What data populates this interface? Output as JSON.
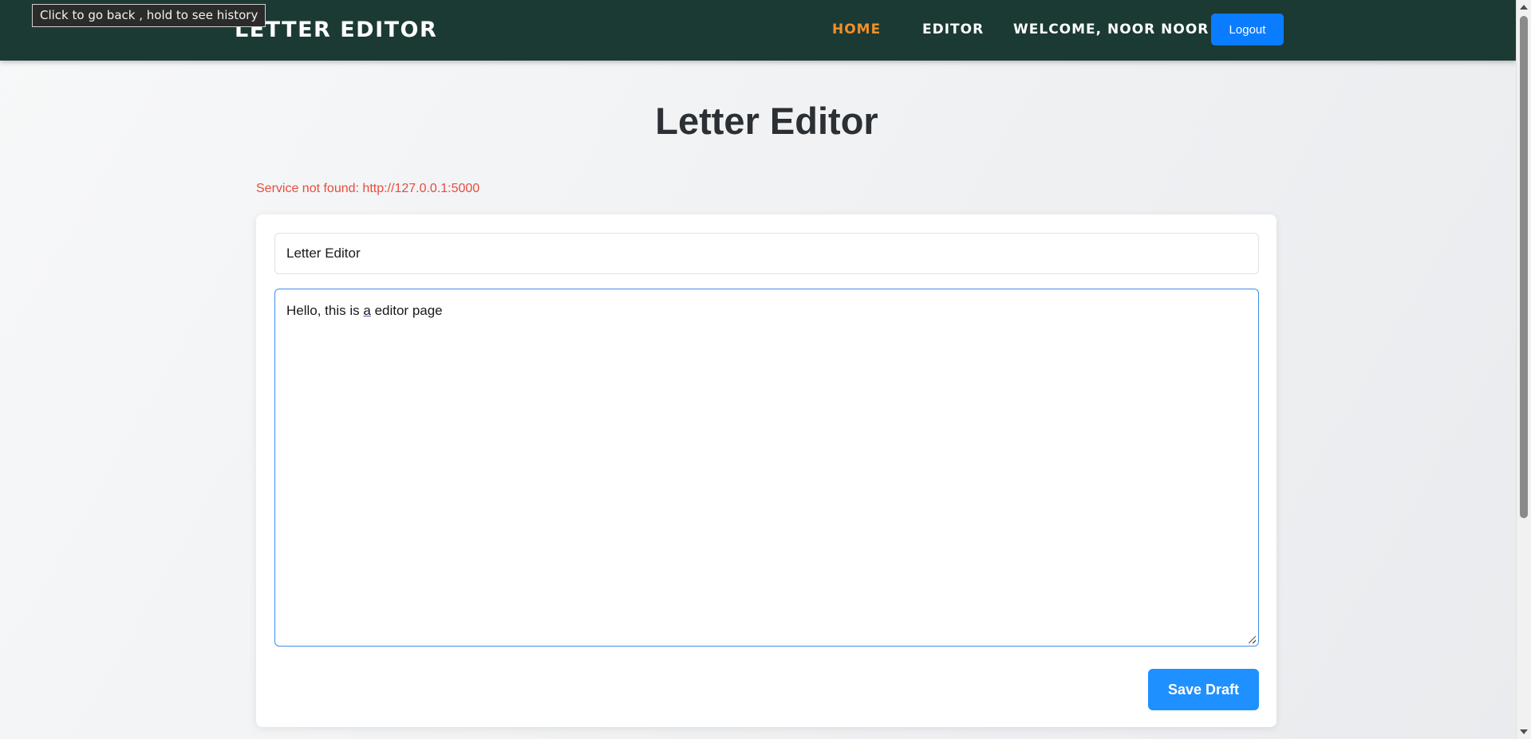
{
  "tooltip": {
    "text": "Click to go back , hold to see history"
  },
  "nav": {
    "brand": "LETTER EDITOR",
    "links": [
      {
        "label": "HOME",
        "active": true
      },
      {
        "label": "EDITOR",
        "active": false
      }
    ],
    "welcome": "WELCOME, NOOR NOOR",
    "logout_label": "Logout"
  },
  "main": {
    "title": "Letter Editor",
    "error": "Service not found: http://127.0.0.1:5000",
    "form": {
      "title_value": "Letter Editor",
      "body_before": "Hello, this is ",
      "body_flagged": "a",
      "body_after": " editor page",
      "save_label": "Save Draft"
    }
  },
  "colors": {
    "navbar_bg": "#1c3a34",
    "active_link": "#f0902a",
    "logout_bg": "#0a7cff",
    "save_bg": "#1e90ff",
    "error": "#e74c3c",
    "textarea_focus_border": "#3d8fe8"
  },
  "icons": {
    "resize_handle": "textarea-resize-grip-icon"
  }
}
